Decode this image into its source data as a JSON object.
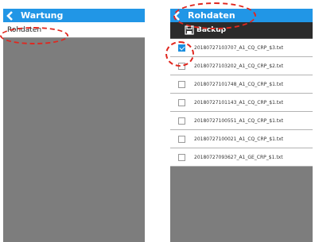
{
  "left_panel": {
    "title": "Wartung",
    "items": [
      {
        "label": "Rohdaten"
      }
    ]
  },
  "right_panel": {
    "title": "Rohdaten",
    "toolbar": {
      "backup_label": "Backup",
      "backup_icon": "save-icon"
    },
    "files": [
      {
        "name": "20180727103707_A1_CQ_CRP_$3.txt",
        "checked": true
      },
      {
        "name": "20180727103202_A1_CQ_CRP_$2.txt",
        "checked": false
      },
      {
        "name": "20180727101748_A1_CQ_CRP_$1.txt",
        "checked": false
      },
      {
        "name": "20180727101143_A1_CQ_CRP_$1.txt",
        "checked": false
      },
      {
        "name": "20180727100551_A1_CQ_CRP_$1.txt",
        "checked": false
      },
      {
        "name": "20180727100021_A1_CQ_CRP_$1.txt",
        "checked": false
      },
      {
        "name": "20180727093627_A1_GE_CRP_$1.txt",
        "checked": false
      }
    ]
  },
  "colors": {
    "titlebar": "#2196e6",
    "toolbar": "#2b2b2b",
    "panel_bg": "#7d7d7d",
    "highlight": "#e0271f",
    "checkbox": "#1a8fe0"
  }
}
